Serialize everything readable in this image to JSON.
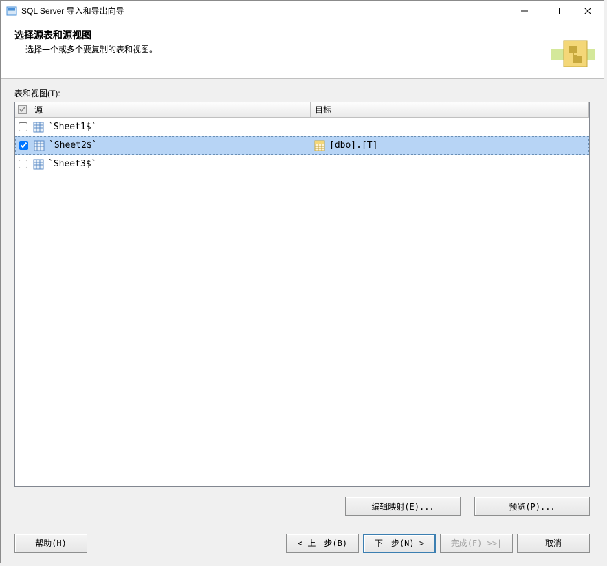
{
  "window": {
    "title": "SQL Server 导入和导出向导"
  },
  "header": {
    "title": "选择源表和源视图",
    "subtitle": "选择一个或多个要复制的表和视图。"
  },
  "content": {
    "table_label": "表和视图(T):",
    "columns": {
      "source": "源",
      "target": "目标"
    },
    "rows": [
      {
        "checked": false,
        "source": "`Sheet1$`",
        "target": "",
        "selected": false
      },
      {
        "checked": true,
        "source": "`Sheet2$`",
        "target": "[dbo].[T]",
        "selected": true
      },
      {
        "checked": false,
        "source": "`Sheet3$`",
        "target": "",
        "selected": false
      }
    ]
  },
  "actions": {
    "edit_mappings": "编辑映射(E)...",
    "preview": "预览(P)..."
  },
  "footer": {
    "help": "帮助(H)",
    "back": "< 上一步(B)",
    "next": "下一步(N) >",
    "finish": "完成(F) >>|",
    "cancel": "取消"
  }
}
